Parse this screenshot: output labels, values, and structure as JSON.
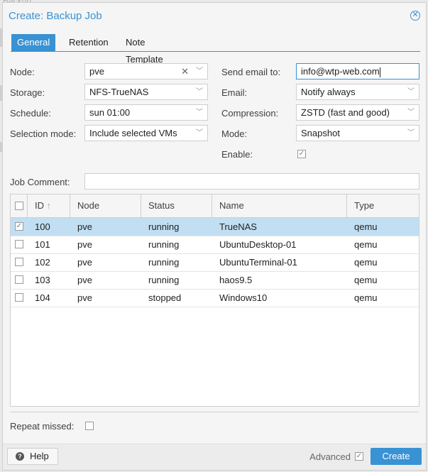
{
  "background": {
    "text": "Backup"
  },
  "dialog": {
    "title": "Create: Backup Job",
    "close_icon": "close-circle-icon",
    "tabs": [
      {
        "label": "General",
        "active": true
      },
      {
        "label": "Retention",
        "active": false
      },
      {
        "label": "Note Template",
        "active": false
      }
    ]
  },
  "form": {
    "node": {
      "label": "Node:",
      "value": "pve"
    },
    "storage": {
      "label": "Storage:",
      "value": "NFS-TrueNAS"
    },
    "schedule": {
      "label": "Schedule:",
      "value": "sun 01:00"
    },
    "selection_mode": {
      "label": "Selection mode:",
      "value": "Include selected VMs"
    },
    "send_email": {
      "label": "Send email to:",
      "value": "info@wtp-web.com"
    },
    "email": {
      "label": "Email:",
      "value": "Notify always"
    },
    "compression": {
      "label": "Compression:",
      "value": "ZSTD (fast and good)"
    },
    "mode": {
      "label": "Mode:",
      "value": "Snapshot"
    },
    "enable": {
      "label": "Enable:",
      "checked": true
    },
    "job_comment": {
      "label": "Job Comment:",
      "value": ""
    }
  },
  "grid": {
    "columns": [
      "ID",
      "Node",
      "Status",
      "Name",
      "Type"
    ],
    "sort_icon": "arrow-up-icon",
    "rows": [
      {
        "id": "100",
        "node": "pve",
        "status": "running",
        "name": "TrueNAS",
        "type": "qemu",
        "selected": true
      },
      {
        "id": "101",
        "node": "pve",
        "status": "running",
        "name": "UbuntuDesktop-01",
        "type": "qemu",
        "selected": false
      },
      {
        "id": "102",
        "node": "pve",
        "status": "running",
        "name": "UbuntuTerminal-01",
        "type": "qemu",
        "selected": false
      },
      {
        "id": "103",
        "node": "pve",
        "status": "running",
        "name": "haos9.5",
        "type": "qemu",
        "selected": false
      },
      {
        "id": "104",
        "node": "pve",
        "status": "stopped",
        "name": "Windows10",
        "type": "qemu",
        "selected": false
      }
    ]
  },
  "repeat_missed": {
    "label": "Repeat missed:",
    "checked": false
  },
  "footer": {
    "help_label": "Help",
    "advanced_label": "Advanced",
    "advanced_checked": true,
    "create_label": "Create"
  },
  "colors": {
    "accent": "#3892d4",
    "selected_row": "#c1def2"
  }
}
